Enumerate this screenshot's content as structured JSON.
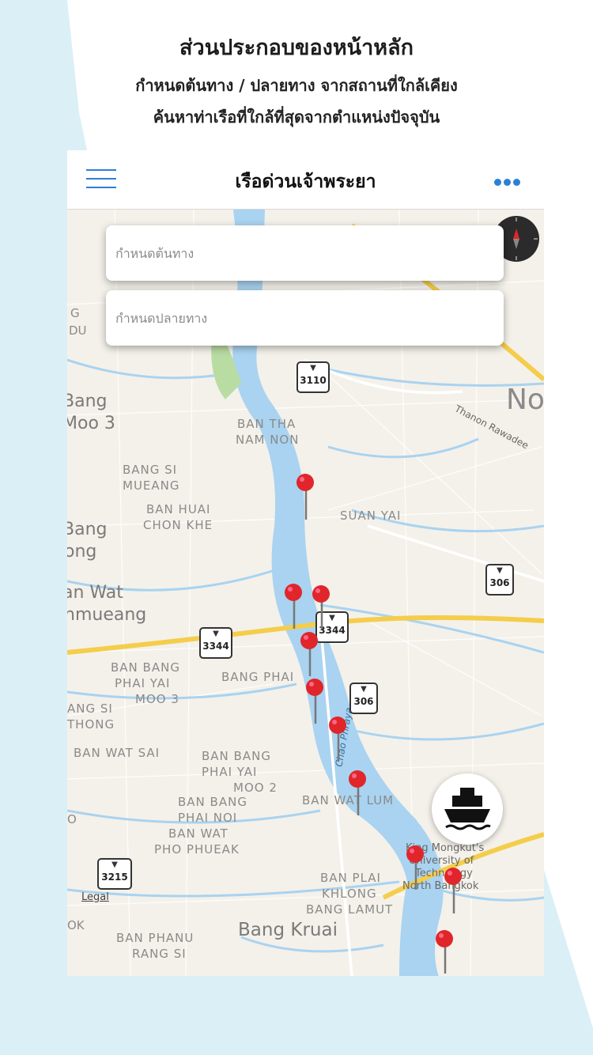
{
  "header": {
    "title": "ส่วนประกอบของหน้าหลัก",
    "line1": "กำหนดต้นทาง / ปลายทาง จากสถานที่ใกล้เคียง",
    "line2": "ค้นหาท่าเรือที่ใกล้ที่สุดจากตำแหน่งปัจจุบัน"
  },
  "navbar": {
    "title": "เรือด่วนเจ้าพระยา",
    "menu_icon": "hamburger-icon",
    "more_icon": "ellipsis-icon"
  },
  "search": {
    "origin_placeholder": "กำหนดต้นทาง",
    "destination_placeholder": "กำหนดปลายทาง"
  },
  "map": {
    "legal": "Legal",
    "river_label": "Chao Phraya",
    "road_label": "Thanon Rawadee",
    "labels": [
      "BAN THA",
      "NAM NON",
      "BANG SI",
      "MUEANG",
      "BAN HUAI",
      "CHON KHE",
      "SUAN YAI",
      "BAN BANG",
      "PHAI YAI",
      "MOO 3",
      "BANG PHAI",
      "BAN WAT SAI",
      "BAN BANG",
      "PHAI YAI",
      "MOO 2",
      "BAN BANG",
      "PHAI NOI",
      "BAN WAT",
      "PHO PHUEAK",
      "BAN WAT LUM",
      "BAN PLAI",
      "KHLONG",
      "BANG LAMUT",
      "Bang Kruai",
      "BAN PHANU",
      "RANG SI",
      "King Mongkut's",
      "University of",
      "Technology",
      "North Bangkok",
      "Bang",
      "Moo 3",
      "Bang",
      "ong",
      "an Wat",
      "nmueang",
      "No",
      "G",
      "DU",
      "ANG SI",
      "THONG",
      "O",
      "OK"
    ],
    "route_shields": [
      "3110",
      "3344",
      "3344",
      "306",
      "306",
      "3215"
    ],
    "colors": {
      "water": "#a9d3f0",
      "land": "#f4f1ea",
      "highway": "#f4cd4b",
      "pin": "#e0262b"
    }
  },
  "icons": {
    "compass": "compass-icon",
    "boat": "boat-icon",
    "pin": "map-pin-icon"
  }
}
